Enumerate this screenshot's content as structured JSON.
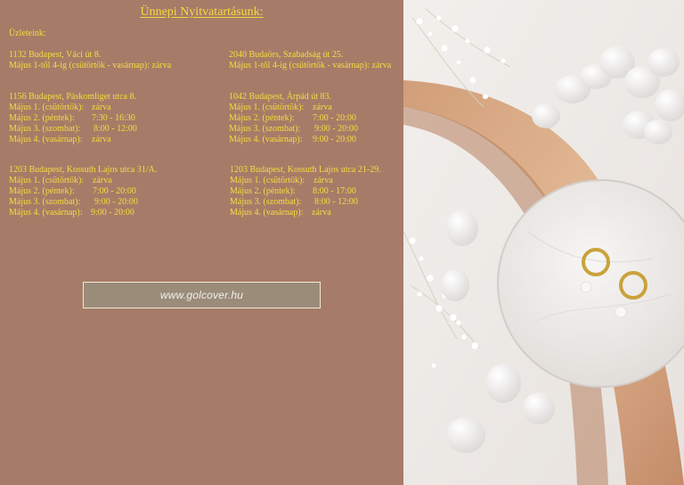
{
  "title": "Ünnepi Nyitvatartásunk:",
  "intro": "Üzleteink:",
  "stores": [
    {
      "address": "1132 Budapest, Váci út 8.",
      "lines": [
        {
          "day": "Május 1-től 4-ig (csütörtök - vasárnap):",
          "hours": "zárva"
        }
      ]
    },
    {
      "address": "2040 Budaörs, Szabadság út 25.",
      "lines": [
        {
          "day": "Május 1-től 4-ig (csütörtök - vasárnap):",
          "hours": "zárva"
        }
      ]
    },
    {
      "address": "1156 Budapest, Páskomliget utca 8.",
      "lines": [
        {
          "day": "Május 1. (csütörtök):",
          "hours": "zárva"
        },
        {
          "day": "Május 2. (péntek):",
          "hours": "7:30 - 16:30"
        },
        {
          "day": "Május 3. (szombat):",
          "hours": "8:00 - 12:00"
        },
        {
          "day": "Május 4. (vasárnap):",
          "hours": "zárva"
        }
      ]
    },
    {
      "address": "1042 Budapest, Árpád út 83.",
      "lines": [
        {
          "day": "Május 1. (csütörtök):",
          "hours": "zárva"
        },
        {
          "day": "Május 2. (péntek):",
          "hours": "7:00 - 20:00"
        },
        {
          "day": "Május 3. (szombat):",
          "hours": "9:00 - 20:00"
        },
        {
          "day": "Május 4. (vasárnap):",
          "hours": "9:00 - 20:00"
        }
      ]
    },
    {
      "address": "1203 Budapest, Kossuth Lajos utca 31/A.",
      "lines": [
        {
          "day": "Május 1. (csütörtök):",
          "hours": "zárva"
        },
        {
          "day": "Május 2. (péntek):",
          "hours": "7:00 - 20:00"
        },
        {
          "day": "Május 3. (szombat):",
          "hours": "9:00 - 20:00"
        },
        {
          "day": "Május 4. (vasárnap):",
          "hours": "9:00 - 20:00"
        }
      ]
    },
    {
      "address": "1203 Budapest, Kossuth Lajos utca 21-29.",
      "lines": [
        {
          "day": "Május 1. (csütörtök):",
          "hours": "zárva"
        },
        {
          "day": "Május 2. (péntek):",
          "hours": "8:00 - 17:00"
        },
        {
          "day": "Május 3. (szombat):",
          "hours": "8:00 - 12:00"
        },
        {
          "day": "Május 4. (vasárnap):",
          "hours": "zárva"
        }
      ]
    }
  ],
  "website": "www.golcover.hu",
  "colors": {
    "background": "#a67c68",
    "text": "#f6dc3f",
    "link_box": "#9b8c7a",
    "link_text": "#f4f0ea"
  },
  "photo": {
    "subject": "earrings-on-marble-photo"
  }
}
